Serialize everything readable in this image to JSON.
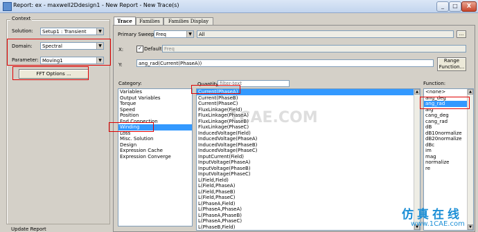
{
  "window": {
    "title": "Report: ex - maxwell2Ddesign1 - New Report - New Trace(s)",
    "buttons": {
      "minimize": "_",
      "maximize": "□",
      "close": "X"
    }
  },
  "context": {
    "group_label": "Context",
    "solution_label": "Solution:",
    "solution_value": "Setup1 : Transient",
    "domain_label": "Domain:",
    "domain_value": "Spectral",
    "parameter_label": "Parameter:",
    "parameter_value": "Moving1",
    "fft_button": "FFT Options ...",
    "update_report_label": "Update Report"
  },
  "tabs": [
    "Trace",
    "Families",
    "Families Display"
  ],
  "trace": {
    "primary_sweep_label": "Primary Sweep:",
    "primary_sweep_value": "Freq",
    "primary_sweep_range": "All",
    "ellipsis": "...",
    "x_label": "X:",
    "default_label": "Default",
    "x_value": "Freq",
    "y_label": "Y:",
    "y_value": "ang_rad(Current(PhaseA))",
    "range_button": "Range\nFunction...",
    "category_label": "Category:",
    "quantity_label": "Quantity:",
    "filter_placeholder": "filter-text",
    "function_label": "Function:"
  },
  "categories": [
    "Variables",
    "Output Variables",
    "Torque",
    "Speed",
    "Position",
    "Fnd Connection",
    "Winding",
    "Loss",
    "Misc. Solution",
    "Design",
    "Expression Cache",
    "Expression Converge"
  ],
  "selected_category": "Winding",
  "quantities": [
    "Current(PhaseA)",
    "Current(PhaseB)",
    "Current(PhaseC)",
    "FluxLinkage(Field)",
    "FluxLinkage(PhaseA)",
    "FluxLinkage(PhaseB)",
    "FluxLinkage(PhaseC)",
    "InducedVoltage(Field)",
    "InducedVoltage(PhaseA)",
    "InducedVoltage(PhaseB)",
    "InducedVoltage(PhaseC)",
    "InputCurrent(Field)",
    "InputVoltage(PhaseA)",
    "InputVoltage(PhaseB)",
    "InputVoltage(PhaseC)",
    "L(Field,Field)",
    "L(Field,PhaseA)",
    "L(Field,PhaseB)",
    "L(Field,PhaseC)",
    "L(PhaseA,Field)",
    "L(PhaseA,PhaseA)",
    "L(PhaseA,PhaseB)",
    "L(PhaseA,PhaseC)",
    "L(PhaseB,Field)"
  ],
  "selected_quantity": "Current(PhaseA)",
  "functions": [
    "<none>",
    "ang_deg",
    "ang_rad",
    "arg",
    "cang_deg",
    "cang_rad",
    "dB",
    "dB10normalize",
    "dB20normalize",
    "dBc",
    "im",
    "mag",
    "normalize",
    "re"
  ],
  "selected_function": "ang_rad",
  "watermark": "1CAE.COM",
  "brand": {
    "cn": "仿真在线",
    "en": "www.1CAE.com"
  },
  "colors": {
    "highlight": "#e00000",
    "selection": "#3399ff",
    "brand": "#1c8fd6"
  }
}
